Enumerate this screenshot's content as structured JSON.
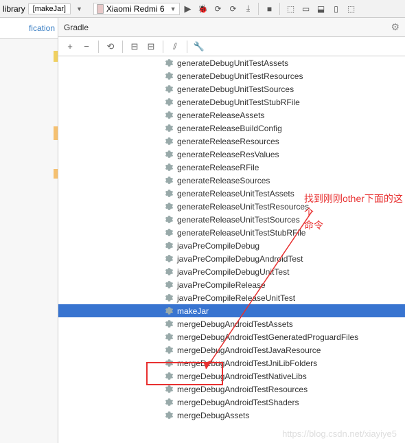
{
  "toolbar": {
    "config_prefix": "library",
    "run_config": "[makeJar]",
    "device": "Xiaomi Redmi 6"
  },
  "sidebar": {
    "notification_label": "fication"
  },
  "panel": {
    "title": "Gradle"
  },
  "tasks": [
    "generateDebugUnitTestAssets",
    "generateDebugUnitTestResources",
    "generateDebugUnitTestSources",
    "generateDebugUnitTestStubRFile",
    "generateReleaseAssets",
    "generateReleaseBuildConfig",
    "generateReleaseResources",
    "generateReleaseResValues",
    "generateReleaseRFile",
    "generateReleaseSources",
    "generateReleaseUnitTestAssets",
    "generateReleaseUnitTestResources",
    "generateReleaseUnitTestSources",
    "generateReleaseUnitTestStubRFile",
    "javaPreCompileDebug",
    "javaPreCompileDebugAndroidTest",
    "javaPreCompileDebugUnitTest",
    "javaPreCompileRelease",
    "javaPreCompileReleaseUnitTest",
    "makeJar",
    "mergeDebugAndroidTestAssets",
    "mergeDebugAndroidTestGeneratedProguardFiles",
    "mergeDebugAndroidTestJavaResource",
    "mergeDebugAndroidTestJniLibFolders",
    "mergeDebugAndroidTestNativeLibs",
    "mergeDebugAndroidTestResources",
    "mergeDebugAndroidTestShaders",
    "mergeDebugAssets"
  ],
  "selected_task_index": 19,
  "annotation": {
    "text_line1": "找到刚刚other下面的这个",
    "text_line2": "命令"
  },
  "watermark": "https://blog.csdn.net/xiayiye5"
}
